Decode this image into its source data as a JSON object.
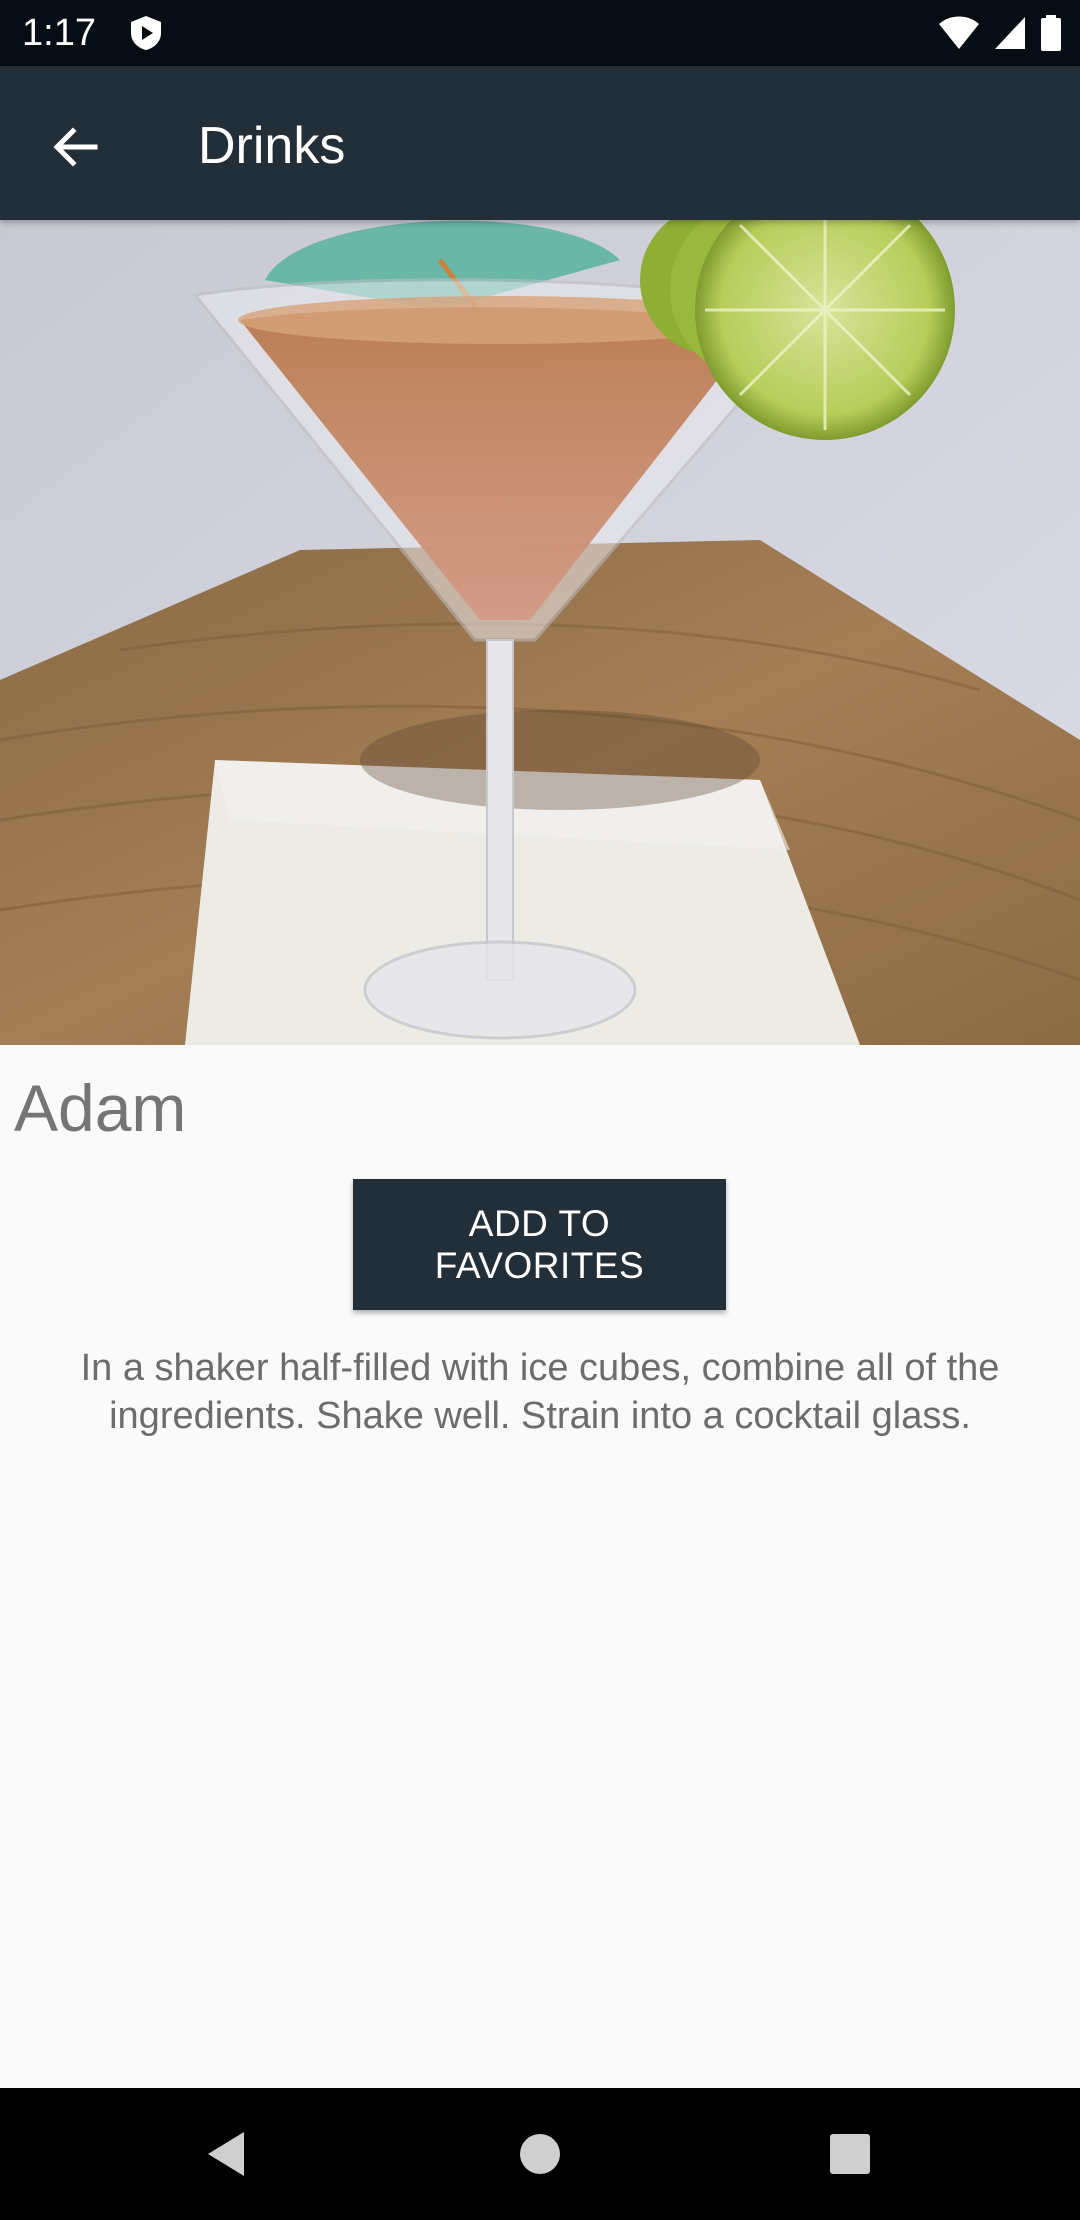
{
  "status_bar": {
    "time": "1:17",
    "icons": [
      "shield-play-icon",
      "wifi-icon",
      "cellular-signal-icon",
      "battery-icon"
    ]
  },
  "app_bar": {
    "title": "Drinks",
    "back_icon": "arrow-left-icon",
    "background_color": "#232f38"
  },
  "drink": {
    "image_alt": "martini glass cocktail with lime wheels and a paper umbrella",
    "name": "Adam",
    "favorite_button_label": "ADD TO FAVORITES",
    "instructions": "In a shaker half-filled with ice cubes, combine all of the ingredients. Shake well. Strain into a cocktail glass."
  },
  "nav_bar": {
    "icons": [
      "back-triangle-icon",
      "home-circle-icon",
      "recents-square-icon"
    ]
  }
}
